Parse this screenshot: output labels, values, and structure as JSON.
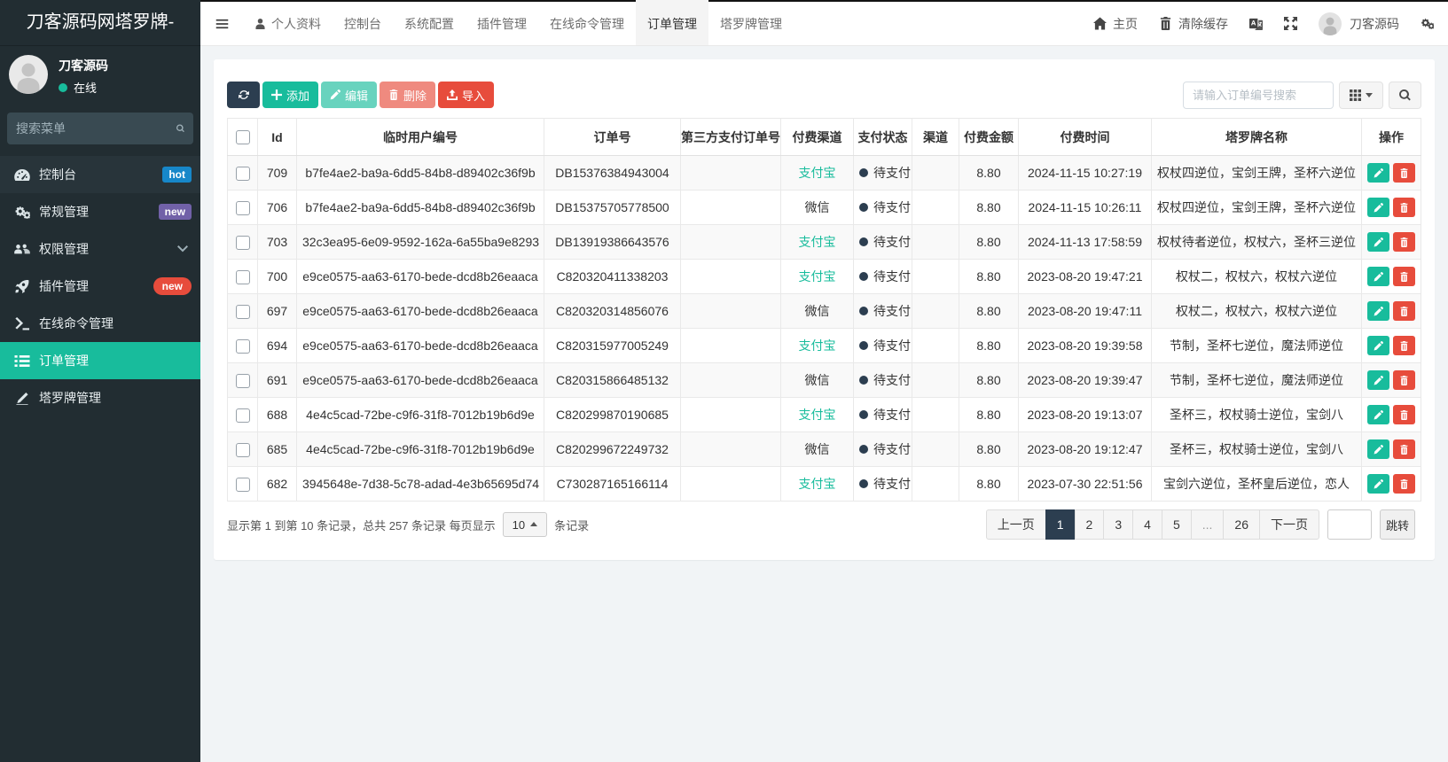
{
  "colors": {
    "sidebar_bg": "#222d32",
    "accent_green": "#18bc9c",
    "primary_navy": "#2c3e50",
    "danger_red": "#e74c3c",
    "badge_blue": "#1787c9",
    "badge_purple": "#7161a8",
    "content_bg": "#f1f4f6"
  },
  "sidebar": {
    "logo": "刀客源码网塔罗牌-",
    "user": {
      "name": "刀客源码",
      "status": "在线"
    },
    "search_placeholder": "搜索菜单",
    "menu": [
      {
        "label": "控制台",
        "icon": "tachometer-icon",
        "badge": "hot",
        "badge_type": "blue",
        "subtle": true
      },
      {
        "label": "常规管理",
        "icon": "cogs-icon",
        "badge": "new",
        "badge_type": "purple"
      },
      {
        "label": "权限管理",
        "icon": "users-icon",
        "chevron": true
      },
      {
        "label": "插件管理",
        "icon": "rocket-icon",
        "badge": "new",
        "badge_type": "redpill"
      },
      {
        "label": "在线命令管理",
        "icon": "terminal-icon"
      },
      {
        "label": "订单管理",
        "icon": "list-icon",
        "active": true
      },
      {
        "label": "塔罗牌管理",
        "icon": "pen-icon"
      }
    ]
  },
  "topbar": {
    "tabs": [
      {
        "label": "个人资料",
        "icon": "user-icon"
      },
      {
        "label": "控制台"
      },
      {
        "label": "系统配置"
      },
      {
        "label": "插件管理"
      },
      {
        "label": "在线命令管理"
      },
      {
        "label": "订单管理",
        "active": true
      },
      {
        "label": "塔罗牌管理"
      }
    ],
    "right": [
      {
        "label": "主页",
        "icon": "home-icon",
        "name": "home-link"
      },
      {
        "label": "清除缓存",
        "icon": "trash-icon",
        "name": "clear-cache-link"
      },
      {
        "label": "",
        "icon": "language-icon",
        "name": "language-switch"
      },
      {
        "label": "",
        "icon": "expand-icon",
        "name": "fullscreen-toggle"
      },
      {
        "label": "刀客源码",
        "icon": "avatar",
        "name": "user-menu"
      },
      {
        "label": "",
        "icon": "gears-icon",
        "name": "settings-menu"
      }
    ]
  },
  "toolbar": {
    "add_label": "添加",
    "edit_label": "编辑",
    "delete_label": "删除",
    "import_label": "导入",
    "search_placeholder": "请输入订单编号搜索"
  },
  "table": {
    "columns": [
      "Id",
      "临时用户编号",
      "订单号",
      "第三方支付订单号",
      "付费渠道",
      "支付状态",
      "渠道",
      "付费金额",
      "付费时间",
      "塔罗牌名称",
      "操作"
    ],
    "pay_status_label": "待支付",
    "rows": [
      {
        "id": "709",
        "user_no": "b7fe4ae2-ba9a-6dd5-84b8-d89402c36f9b",
        "order_no": "DB15376384943004",
        "third_no": "",
        "pay_channel": "支付宝",
        "channel_type": "alipay",
        "pay_status": "待支付",
        "channel": "",
        "amount": "8.80",
        "pay_time": "2024-11-15 10:27:19",
        "tarot": "权杖四逆位，宝剑王牌，圣杯六逆位"
      },
      {
        "id": "706",
        "user_no": "b7fe4ae2-ba9a-6dd5-84b8-d89402c36f9b",
        "order_no": "DB15375705778500",
        "third_no": "",
        "pay_channel": "微信",
        "channel_type": "wechat",
        "pay_status": "待支付",
        "channel": "",
        "amount": "8.80",
        "pay_time": "2024-11-15 10:26:11",
        "tarot": "权杖四逆位，宝剑王牌，圣杯六逆位"
      },
      {
        "id": "703",
        "user_no": "32c3ea95-6e09-9592-162a-6a55ba9e8293",
        "order_no": "DB13919386643576",
        "third_no": "",
        "pay_channel": "支付宝",
        "channel_type": "alipay",
        "pay_status": "待支付",
        "channel": "",
        "amount": "8.80",
        "pay_time": "2024-11-13 17:58:59",
        "tarot": "权杖待者逆位，权杖六，圣杯三逆位"
      },
      {
        "id": "700",
        "user_no": "e9ce0575-aa63-6170-bede-dcd8b26eaaca",
        "order_no": "C820320411338203",
        "third_no": "",
        "pay_channel": "支付宝",
        "channel_type": "alipay",
        "pay_status": "待支付",
        "channel": "",
        "amount": "8.80",
        "pay_time": "2023-08-20 19:47:21",
        "tarot": "权杖二，权杖六，权杖六逆位"
      },
      {
        "id": "697",
        "user_no": "e9ce0575-aa63-6170-bede-dcd8b26eaaca",
        "order_no": "C820320314856076",
        "third_no": "",
        "pay_channel": "微信",
        "channel_type": "wechat",
        "pay_status": "待支付",
        "channel": "",
        "amount": "8.80",
        "pay_time": "2023-08-20 19:47:11",
        "tarot": "权杖二，权杖六，权杖六逆位"
      },
      {
        "id": "694",
        "user_no": "e9ce0575-aa63-6170-bede-dcd8b26eaaca",
        "order_no": "C820315977005249",
        "third_no": "",
        "pay_channel": "支付宝",
        "channel_type": "alipay",
        "pay_status": "待支付",
        "channel": "",
        "amount": "8.80",
        "pay_time": "2023-08-20 19:39:58",
        "tarot": "节制，圣杯七逆位，魔法师逆位"
      },
      {
        "id": "691",
        "user_no": "e9ce0575-aa63-6170-bede-dcd8b26eaaca",
        "order_no": "C820315866485132",
        "third_no": "",
        "pay_channel": "微信",
        "channel_type": "wechat",
        "pay_status": "待支付",
        "channel": "",
        "amount": "8.80",
        "pay_time": "2023-08-20 19:39:47",
        "tarot": "节制，圣杯七逆位，魔法师逆位"
      },
      {
        "id": "688",
        "user_no": "4e4c5cad-72be-c9f6-31f8-7012b19b6d9e",
        "order_no": "C820299870190685",
        "third_no": "",
        "pay_channel": "支付宝",
        "channel_type": "alipay",
        "pay_status": "待支付",
        "channel": "",
        "amount": "8.80",
        "pay_time": "2023-08-20 19:13:07",
        "tarot": "圣杯三，权杖骑士逆位，宝剑八"
      },
      {
        "id": "685",
        "user_no": "4e4c5cad-72be-c9f6-31f8-7012b19b6d9e",
        "order_no": "C820299672249732",
        "third_no": "",
        "pay_channel": "微信",
        "channel_type": "wechat",
        "pay_status": "待支付",
        "channel": "",
        "amount": "8.80",
        "pay_time": "2023-08-20 19:12:47",
        "tarot": "圣杯三，权杖骑士逆位，宝剑八"
      },
      {
        "id": "682",
        "user_no": "3945648e-7d38-5c78-adad-4e3b65695d74",
        "order_no": "C730287165166114",
        "third_no": "",
        "pay_channel": "支付宝",
        "channel_type": "alipay",
        "pay_status": "待支付",
        "channel": "",
        "amount": "8.80",
        "pay_time": "2023-07-30 22:51:56",
        "tarot": "宝剑六逆位，圣杯皇后逆位，恋人"
      }
    ]
  },
  "footer": {
    "info_prefix": "显示第 1 到第 10 条记录，总共 257 条记录 每页显示",
    "page_size": "10",
    "info_suffix": "条记录",
    "prev_label": "上一页",
    "next_label": "下一页",
    "pages": [
      "1",
      "2",
      "3",
      "4",
      "5",
      "...",
      "26"
    ],
    "active_page": "1",
    "jump_label": "跳转",
    "jump_value": ""
  }
}
